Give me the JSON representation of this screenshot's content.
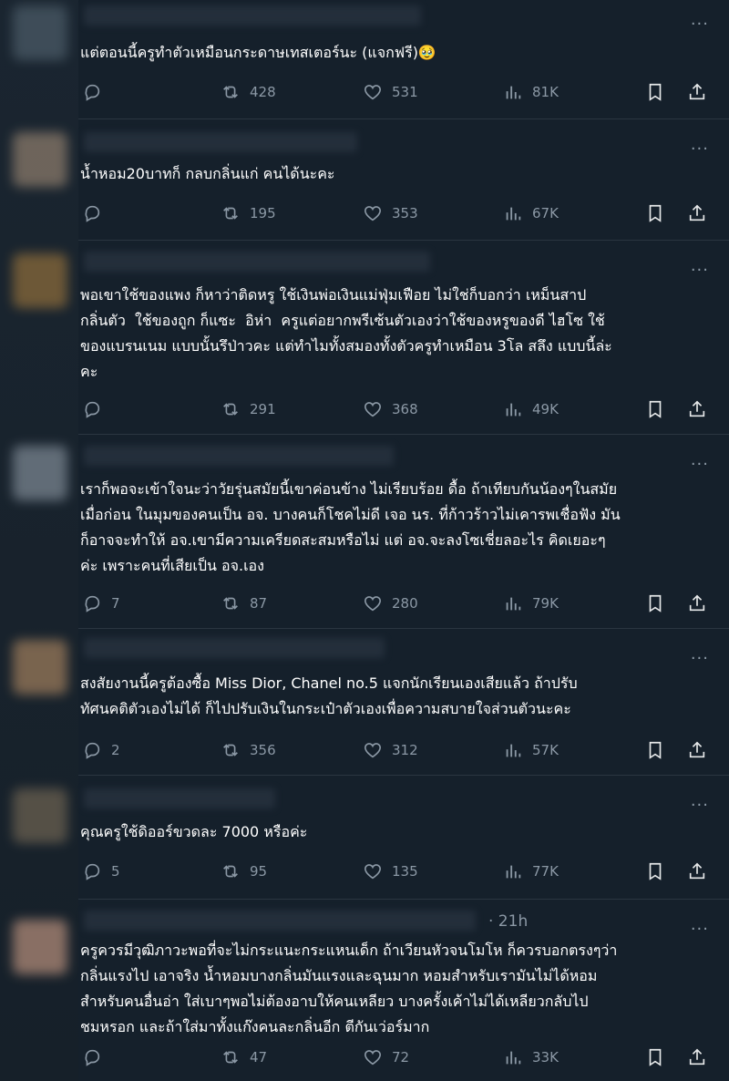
{
  "posts": [
    {
      "text": "แต่ตอนนี้ครูทำตัวเหมือนกระดาษเทสเตอร์นะ (แจกฟรี)🥹",
      "replies": "",
      "retweets": "428",
      "likes": "531",
      "views": "81K",
      "time": ""
    },
    {
      "text": "น้ำหอม20บาทก็ กลบกลิ่นแก่ คนได้นะคะ",
      "replies": "",
      "retweets": "195",
      "likes": "353",
      "views": "67K",
      "time": ""
    },
    {
      "text": "พอเขาใช้ของแพง ก็หาว่าติดหรู ใช้เงินพ่อเงินแม่ฟุ่มเฟือย ไม่ใช่ก็บอกว่า เหม็นสาป\nกลิ่นตัว  ใช้ของถูก ก็แซะ  อิห่า  ครูแต่อยากพรีเซ้นตัวเองว่าใช้ของหรูของดี ไฮโซ ใช้\nของแบรนเนม แบบนั้นรึป่าวคะ แต่ทำไมทั้งสมองทั้งตัวครูทำเหมือน 3โล สลึง แบบนี้ล่ะ\nคะ",
      "replies": "",
      "retweets": "291",
      "likes": "368",
      "views": "49K",
      "time": ""
    },
    {
      "text": "เราก็พอจะเข้าใจนะว่าวัยรุ่นสมัยนี้เขาค่อนข้าง ไม่เรียบร้อย ดื้อ ถ้าเทียบกันน้องๆในสมัย\nเมื่อก่อน ในมุมของคนเป็น อจ. บางคนก็โชคไม่ดี เจอ นร. ที่ก้าวร้าวไม่เคารพเชื่อฟัง มัน\nก็อาจจะทำให้ อจ.เขามีความเครียดสะสมหรือไม่ แต่ อจ.จะลงโซเชี่ยลอะไร คิดเยอะๆ\nค่ะ เพราะคนที่เสียเป็น อจ.เอง",
      "replies": "7",
      "retweets": "87",
      "likes": "280",
      "views": "79K",
      "time": ""
    },
    {
      "text": "สงสัยงานนี้ครูต้องซื้อ Miss Dior, Chanel no.5 แจกนักเรียนเองเสียแล้ว ถ้าปรับ\nทัศนคติตัวเองไม่ได้ ก็ไปปรับเงินในกระเป๋าตัวเองเพื่อความสบายใจส่วนตัวนะคะ",
      "replies": "2",
      "retweets": "356",
      "likes": "312",
      "views": "57K",
      "time": ""
    },
    {
      "text": "คุณครูใช้ดิออร์ขวดละ 7000 หรือค่ะ",
      "replies": "5",
      "retweets": "95",
      "likes": "135",
      "views": "77K",
      "time": ""
    },
    {
      "text": "ครูควรมีวุฒิภาวะพอที่จะไม่กระแนะกระแหนเด็ก ถ้าเวียนหัวจนโมโห ก็ควรบอกตรงๆว่า\nกลิ่นแรงไป เอาจริง น้ำหอมบางกลิ่นมันแรงและฉุนมาก หอมสำหรับเรามันไม่ได้หอม\nสำหรับคนอื่นอ่า ใส่เบาๆพอไม่ต้องอาบให้คนเหลียว บางครั้งเค้าไม่ได้เหลียวกลับไป\nชมหรอก และถ้าใส่มาทั้งแก๊งคนละกลิ่นอีก ตีกันเว่อร์มาก",
      "replies": "",
      "retweets": "47",
      "likes": "72",
      "views": "33K",
      "time": "· 21h"
    }
  ],
  "icons": {
    "reply": "reply-icon",
    "retweet": "retweet-icon",
    "like": "heart-icon",
    "views": "views-icon",
    "bookmark": "bookmark-icon",
    "share": "share-icon",
    "more": "more-icon"
  },
  "colors": {
    "background": "#15202b",
    "text": "#ffffff",
    "muted": "#8b98a5"
  }
}
